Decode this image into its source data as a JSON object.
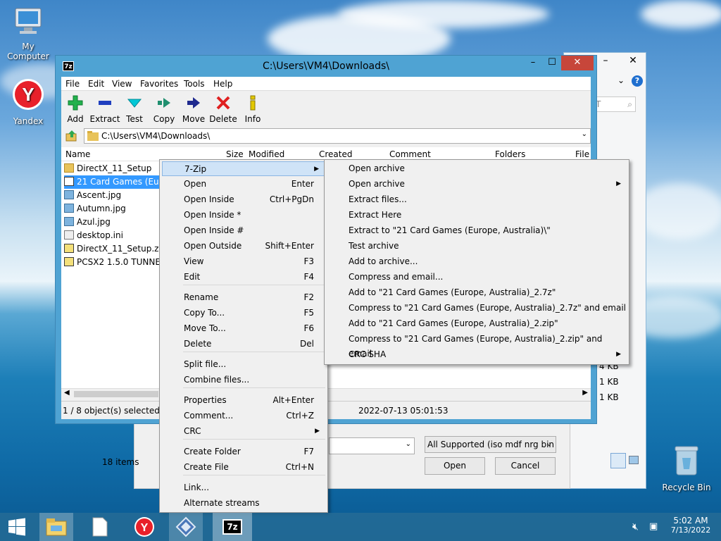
{
  "desktop": {
    "icons": [
      {
        "label": "My Computer",
        "icon": "computer-icon"
      },
      {
        "label": "Yandex",
        "icon": "yandex-icon"
      },
      {
        "label": "Recycle Bin",
        "icon": "recycle-bin-icon"
      }
    ]
  },
  "back_dialog": {
    "search_placeholder": "T",
    "sizes": [
      "4 KB",
      "1 KB",
      "1 KB"
    ],
    "items_count": "18 items",
    "filetype_value": "All Supported (iso mdf nrg bin",
    "open_label": "Open",
    "cancel_label": "Cancel"
  },
  "window": {
    "title": "C:\\Users\\VM4\\Downloads\\",
    "app_icon_text": "7z",
    "menu": [
      "File",
      "Edit",
      "View",
      "Favorites",
      "Tools",
      "Help"
    ],
    "toolbar": [
      {
        "label": "Add",
        "icon": "add-icon",
        "color": "#22b14c"
      },
      {
        "label": "Extract",
        "icon": "extract-icon",
        "color": "#1f3fbf"
      },
      {
        "label": "Test",
        "icon": "test-icon",
        "color": "#00b7c3"
      },
      {
        "label": "Copy",
        "icon": "copy-icon",
        "color": "#1f8f6f"
      },
      {
        "label": "Move",
        "icon": "move-icon",
        "color": "#1f2a8f"
      },
      {
        "label": "Delete",
        "icon": "delete-icon",
        "color": "#e02020"
      },
      {
        "label": "Info",
        "icon": "info-icon",
        "color": "#c8b400"
      }
    ],
    "address": "C:\\Users\\VM4\\Downloads\\",
    "columns": [
      "Name",
      "Size",
      "Modified",
      "Created",
      "Comment",
      "Folders",
      "File"
    ],
    "files": [
      {
        "name": "DirectX_11_Setup",
        "type": "folder",
        "selected": false
      },
      {
        "name": "21 Card Games (Europ",
        "type": "archive",
        "selected": true
      },
      {
        "name": "Ascent.jpg",
        "type": "image",
        "selected": false
      },
      {
        "name": "Autumn.jpg",
        "type": "image",
        "selected": false
      },
      {
        "name": "Azul.jpg",
        "type": "image",
        "selected": false
      },
      {
        "name": "desktop.ini",
        "type": "ini",
        "selected": false
      },
      {
        "name": "DirectX_11_Setup.zip",
        "type": "archive",
        "selected": false
      },
      {
        "name": "PCSX2 1.5.0 TUNNELG",
        "type": "archive",
        "selected": false
      }
    ],
    "status_left": "1 / 8 object(s) selected",
    "status_date": "2022-07-13 05:01:53"
  },
  "context_menu": {
    "items": [
      {
        "label": "7-Zip",
        "shortcut": "",
        "submenu": true,
        "highlighted": true
      },
      {
        "label": "Open",
        "shortcut": "Enter"
      },
      {
        "label": "Open Inside",
        "shortcut": "Ctrl+PgDn"
      },
      {
        "label": "Open Inside *",
        "shortcut": ""
      },
      {
        "label": "Open Inside #",
        "shortcut": ""
      },
      {
        "label": "Open Outside",
        "shortcut": "Shift+Enter"
      },
      {
        "label": "View",
        "shortcut": "F3"
      },
      {
        "label": "Edit",
        "shortcut": "F4"
      },
      {
        "label": "Rename",
        "shortcut": "F2"
      },
      {
        "label": "Copy To...",
        "shortcut": "F5"
      },
      {
        "label": "Move To...",
        "shortcut": "F6"
      },
      {
        "label": "Delete",
        "shortcut": "Del"
      },
      {
        "label": "Split file...",
        "shortcut": ""
      },
      {
        "label": "Combine files...",
        "shortcut": ""
      },
      {
        "label": "Properties",
        "shortcut": "Alt+Enter"
      },
      {
        "label": "Comment...",
        "shortcut": "Ctrl+Z"
      },
      {
        "label": "CRC",
        "shortcut": "",
        "submenu": true
      },
      {
        "label": "Create Folder",
        "shortcut": "F7"
      },
      {
        "label": "Create File",
        "shortcut": "Ctrl+N"
      },
      {
        "label": "Link...",
        "shortcut": ""
      },
      {
        "label": "Alternate streams",
        "shortcut": ""
      }
    ]
  },
  "submenu_7zip": {
    "items": [
      {
        "label": "Open archive",
        "submenu": false
      },
      {
        "label": "Open archive",
        "submenu": true
      },
      {
        "label": "Extract files...",
        "submenu": false
      },
      {
        "label": "Extract Here",
        "submenu": false
      },
      {
        "label": "Extract to \"21 Card Games (Europe, Australia)\\\"",
        "submenu": false
      },
      {
        "label": "Test archive",
        "submenu": false
      },
      {
        "label": "Add to archive...",
        "submenu": false
      },
      {
        "label": "Compress and email...",
        "submenu": false
      },
      {
        "label": "Add to \"21 Card Games (Europe, Australia)_2.7z\"",
        "submenu": false
      },
      {
        "label": "Compress to \"21 Card Games (Europe, Australia)_2.7z\" and email",
        "submenu": false
      },
      {
        "label": "Add to \"21 Card Games (Europe, Australia)_2.zip\"",
        "submenu": false
      },
      {
        "label": "Compress to \"21 Card Games (Europe, Australia)_2.zip\" and email",
        "submenu": false
      },
      {
        "label": "CRC SHA",
        "submenu": true
      }
    ]
  },
  "taskbar": {
    "apps": [
      "start-icon",
      "file-explorer-icon",
      "document-icon",
      "yandex-icon",
      "pcsx2-icon",
      "7zip-icon"
    ],
    "time": "5:02 AM",
    "date": "7/13/2022"
  }
}
